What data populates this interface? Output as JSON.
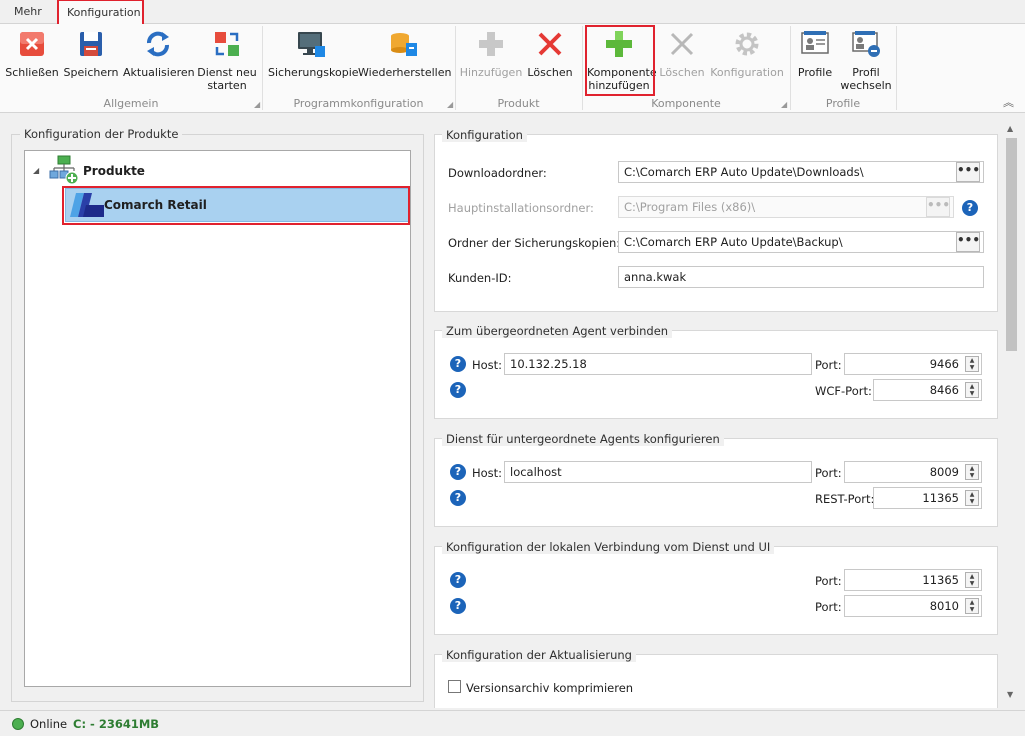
{
  "tabs": {
    "mehr": "Mehr",
    "konfiguration": "Konfiguration"
  },
  "ribbon": {
    "allgemein": {
      "group_label": "Allgemein",
      "close": "Schließen",
      "save": "Speichern",
      "refresh": "Aktualisieren",
      "restart_1": "Dienst neu",
      "restart_2": "starten"
    },
    "programm": {
      "group_label": "Programmkonfiguration",
      "backup": "Sicherungskopie",
      "restore": "Wiederherstellen"
    },
    "produkt": {
      "group_label": "Produkt",
      "add": "Hinzufügen",
      "delete": "Löschen"
    },
    "komponente": {
      "group_label": "Komponente",
      "add_1": "Komponente",
      "add_2": "hinzufügen",
      "delete": "Löschen",
      "config": "Konfiguration"
    },
    "profile": {
      "group_label": "Profile",
      "profile": "Profile",
      "switch_1": "Profil",
      "switch_2": "wechseln"
    }
  },
  "left_panel": {
    "title": "Konfiguration der Produkte",
    "root": "Produkte",
    "child": "Comarch Retail"
  },
  "config": {
    "title": "Konfiguration",
    "download_label": "Downloadordner:",
    "download_value": "C:\\Comarch ERP Auto Update\\Downloads\\",
    "install_label": "Hauptinstallationsordner:",
    "install_value": "C:\\Program Files (x86)\\",
    "backup_label": "Ordner der Sicherungskopien:",
    "backup_value": "C:\\Comarch ERP Auto Update\\Backup\\",
    "customer_label": "Kunden-ID:",
    "customer_value": "anna.kwak",
    "browse": "•••"
  },
  "parent_agent": {
    "title": "Zum übergeordneten Agent verbinden",
    "host_label": "Host:",
    "host_value": "10.132.25.18",
    "port_label": "Port:",
    "port_value": "9466",
    "wcf_label": "WCF-Port:",
    "wcf_value": "8466"
  },
  "child_agents": {
    "title": "Dienst für untergeordnete Agents konfigurieren",
    "host_label": "Host:",
    "host_value": "localhost",
    "port_label": "Port:",
    "port_value": "8009",
    "rest_label": "REST-Port:",
    "rest_value": "11365"
  },
  "local_conn": {
    "title": "Konfiguration der lokalen Verbindung vom Dienst und UI",
    "port1_label": "Port:",
    "port1_value": "11365",
    "port2_label": "Port:",
    "port2_value": "8010"
  },
  "update": {
    "title": "Konfiguration der Aktualisierung",
    "compress_label": "Versionsarchiv komprimieren"
  },
  "help_glyph": "?",
  "status": {
    "online": "Online",
    "disk": "C: - 23641MB"
  },
  "colors": {
    "accent_red": "#e0222e",
    "help_blue": "#1c64b9",
    "selection": "#a9d1f0",
    "online_green": "#4caf50"
  }
}
